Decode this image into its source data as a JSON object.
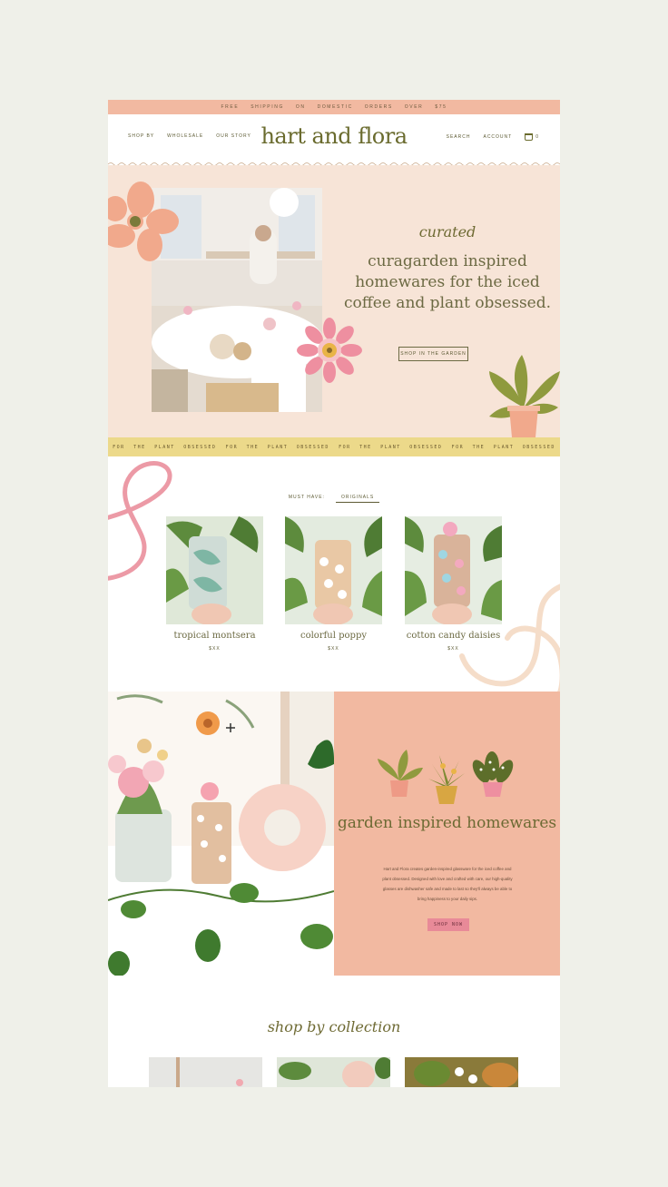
{
  "announcement": {
    "text": "FREE SHIPPING ON DOMESTIC ORDERS OVER $75"
  },
  "header": {
    "logo": "hart and flora",
    "nav_left": [
      "SHOP BY",
      "WHOLESALE",
      "OUR STORY"
    ],
    "nav_right": [
      "SEARCH",
      "ACCOUNT"
    ],
    "cart_count": "0",
    "icons": [
      "cart-icon"
    ]
  },
  "hero": {
    "script_word": "curated",
    "headline": "curagarden inspired homewares for the iced coffee and plant obsessed.",
    "button": "SHOP IN THE GARDEN"
  },
  "marquee": {
    "items": [
      "FOR THE PLANT OBSESSED",
      "FOR THE PLANT OBSESSED",
      "FOR THE PLANT OBSESSED",
      "FOR THE PLANT OBSESSED"
    ]
  },
  "products": {
    "tab_label": "MUST HAVE:",
    "tab_active": "ORIGINALS",
    "items": [
      {
        "name": "tropical montsera",
        "price": "$XX"
      },
      {
        "name": "colorful poppy",
        "price": "$XX"
      },
      {
        "name": "cotton candy daisies",
        "price": "$XX"
      }
    ]
  },
  "story": {
    "title": "garden inspired homewares",
    "body": "Hart and Flora creates garden-inspired glassware for the iced coffee and plant obsessed. Designed with love and crafted with care, our high-quality glasses are dishwasher safe and made to last so they'll always be able to bring happiness to your daily sips.",
    "button": "SHOP NOW"
  },
  "collection": {
    "title": "shop by collection"
  },
  "colors": {
    "page_bg": "#eff0e9",
    "announcement_bg": "#f2b9a1",
    "hero_bg": "#f7e4d7",
    "marquee_bg": "#ecd98a",
    "accent_pink": "#e88a98",
    "olive_text": "#6c6a43"
  }
}
